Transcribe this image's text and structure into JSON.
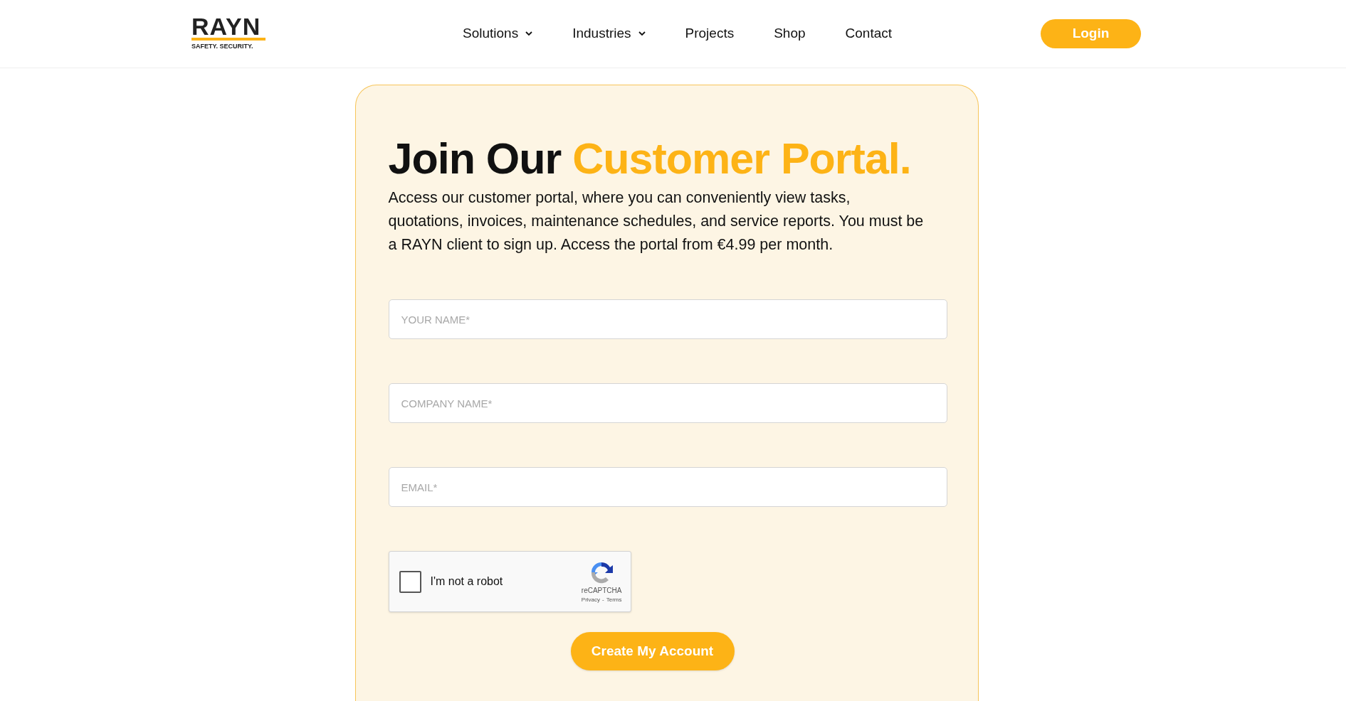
{
  "logo": {
    "wordmark": "RAYN",
    "tagline": "SAFETY. SECURITY."
  },
  "nav": [
    {
      "label": "Solutions",
      "dropdown": true
    },
    {
      "label": "Industries",
      "dropdown": true
    },
    {
      "label": "Projects",
      "dropdown": false
    },
    {
      "label": "Shop",
      "dropdown": false
    },
    {
      "label": "Contact",
      "dropdown": false
    }
  ],
  "login_button": "Login",
  "card": {
    "heading": "Join Our",
    "heading_highlight": "Customer Portal.",
    "intro": "Access our customer portal, where you can conveniently view tasks, quotations, invoices, maintenance schedules, and service reports. You must be a RAYN client to sign up. Access the portal from €4.99 per month.",
    "fields": [
      {
        "placeholder": "YOUR NAME*"
      },
      {
        "placeholder": "COMPANY NAME*"
      },
      {
        "placeholder": "EMAIL*"
      }
    ],
    "captcha": {
      "label": "I'm not a robot",
      "checked": false,
      "brand": "reCAPTCHA",
      "privacy": "Privacy",
      "separator": "-",
      "terms": "Terms"
    },
    "submit_button": "Create My Account"
  }
}
